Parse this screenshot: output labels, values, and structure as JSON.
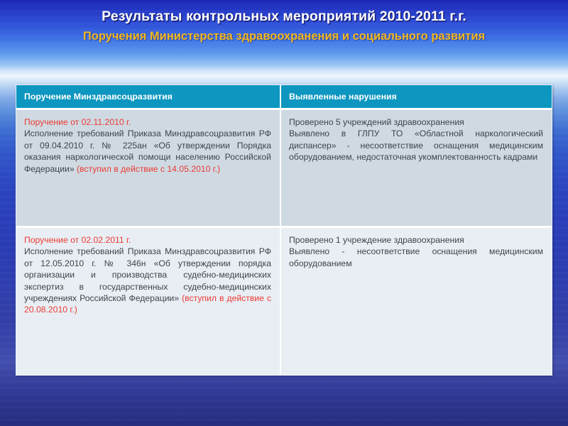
{
  "slide": {
    "title": "Результаты контрольных мероприятий 2010-2011 г.г.",
    "subtitle": "Поручения Министерства здравоохранения и социального развития",
    "colors": {
      "title_text": "#ffffff",
      "subtitle_text": "#f2b81e",
      "table_header_bg": "#0d96c0",
      "table_header_text": "#ffffff",
      "row1_bg": "#ced9e2",
      "row2_bg": "#e8eef4",
      "body_text": "#3f4448",
      "accent_text": "#ee3b33",
      "background_top": "#1b27b4",
      "background_horizon": "#eef6fd",
      "background_bottom": "#252c7e"
    }
  },
  "table": {
    "headers": [
      "Поручение Минздравсоцразвития",
      "Выявленные нарушения"
    ],
    "rows": [
      {
        "left": {
          "heading": "Поручение от 02.11.2010 г.",
          "body_pre": "Исполнение требований Приказа Минздравсоцразвития РФ от 09.04.2010 г. № 225ан «Об утверждении Порядка оказания наркологической помощи населению Российской Федерации» ",
          "body_accent": "(вступил в действие с 14.05.2010 г.)"
        },
        "right": {
          "line1": "Проверено 5 учреждений здравоохранения",
          "line2": "Выявлено в ГЛПУ ТО «Областной наркологический диспансер» - несоответствие оснащения медицинским оборудованием, недостаточная укомплектованность кадрами"
        }
      },
      {
        "left": {
          "heading": "Поручение от 02.02.2011 г.",
          "body_pre": "Исполнение требований Приказа Минздравсоцразвития РФ от 12.05.2010 г. № 346н «Об утверждении порядка организации и производства судебно-медицинских экспертиз в государственных судебно-медицинских учреждениях Российской Федерации» ",
          "body_accent": "(вступил в действие с 20.08.2010 г.)"
        },
        "right": {
          "line1": "Проверено 1 учреждение здравоохранения",
          "line2": "Выявлено - несоответствие оснащения медицинским оборудованием"
        }
      }
    ]
  }
}
